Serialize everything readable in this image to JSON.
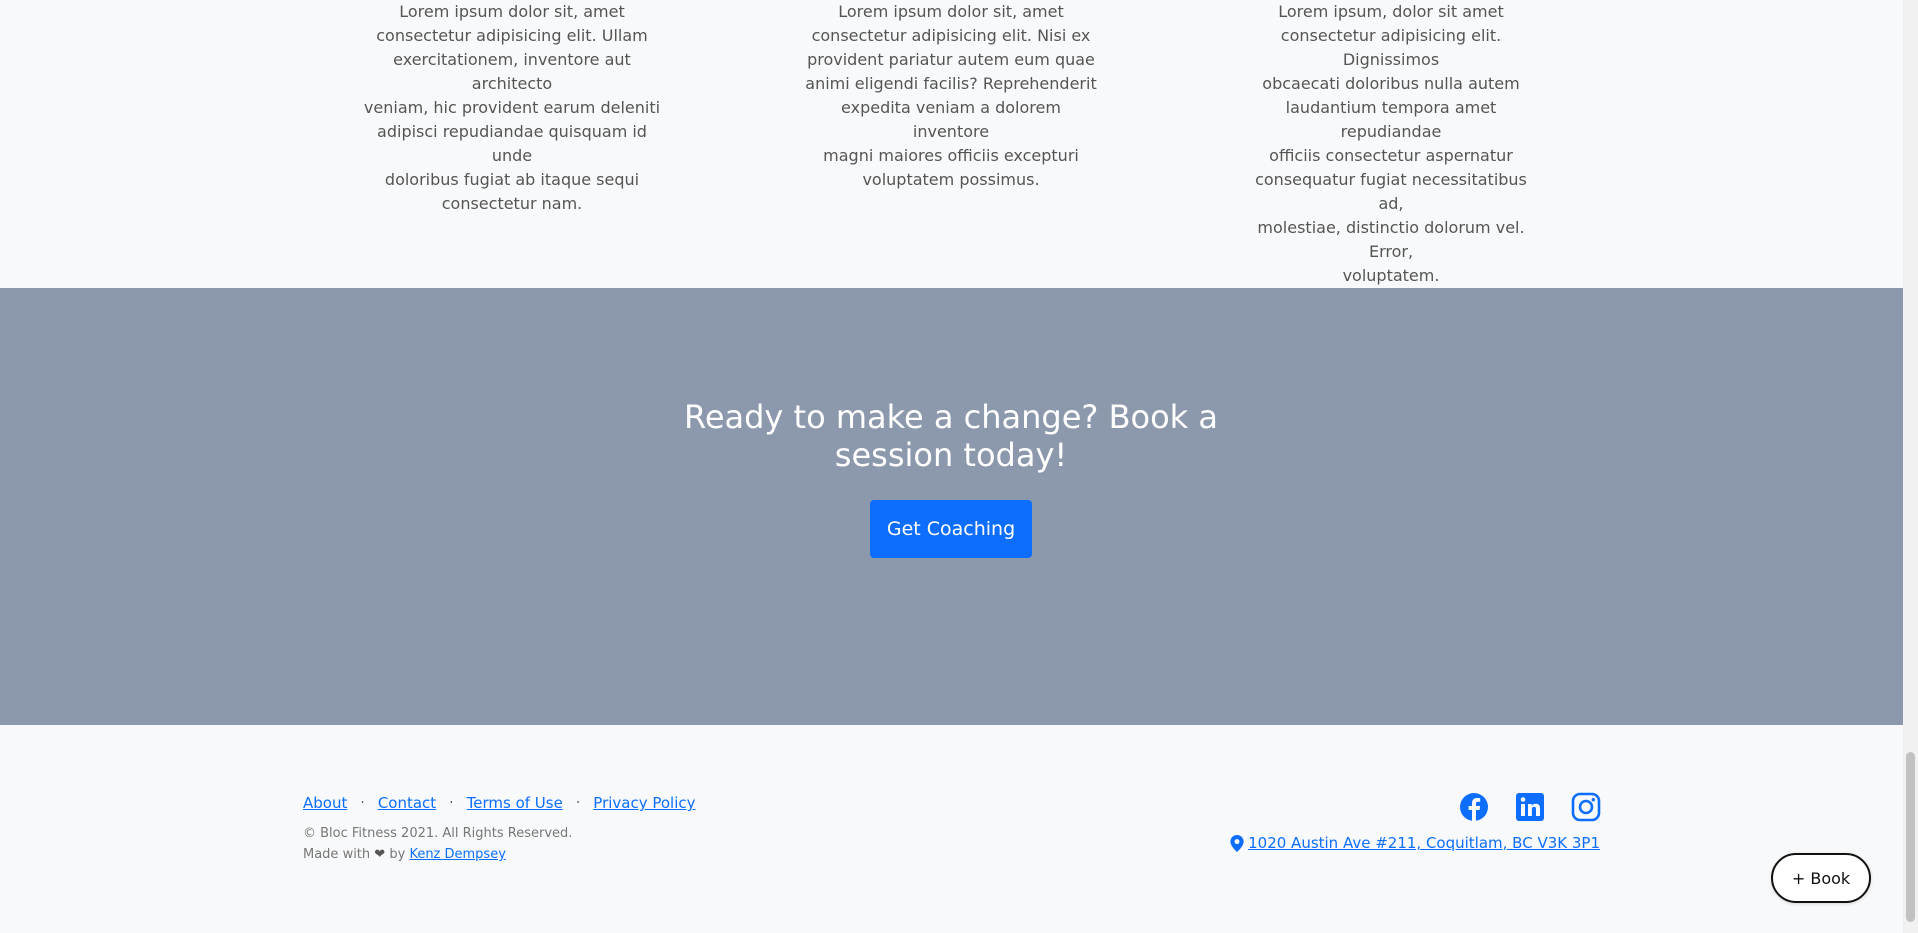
{
  "features": [
    {
      "text": "Lorem ipsum dolor sit, amet\nconsectetur adipisicing elit. Ullam\nexercitationem, inventore aut architecto\nveniam, hic provident earum deleniti\nadipisci repudiandae quisquam id unde\ndoloribus fugiat ab itaque sequi\nconsectetur nam."
    },
    {
      "text": "Lorem ipsum dolor sit, amet\nconsectetur adipisicing elit. Nisi ex\nprovident pariatur autem eum quae\nanimi eligendi facilis? Reprehenderit\nexpedita veniam a dolorem inventore\nmagni maiores officiis excepturi\nvoluptatem possimus."
    },
    {
      "text": "Lorem ipsum, dolor sit amet\nconsectetur adipisicing elit. Dignissimos\nobcaecati doloribus nulla autem\nlaudantium tempora amet repudiandae\nofficiis consectetur aspernatur\nconsequatur fugiat necessitatibus ad,\nmolestiae, distinctio dolorum vel. Error,\nvoluptatem."
    }
  ],
  "cta": {
    "heading": "Ready to make a change? Book a session today!",
    "button_label": "Get Coaching"
  },
  "footer": {
    "links": [
      "About",
      "Contact",
      "Terms of Use",
      "Privacy Policy"
    ],
    "separator": "·",
    "copyright": "© Bloc Fitness 2021. All Rights Reserved.",
    "made_with_prefix": "Made with",
    "made_with_by": "by",
    "author": "Kenz Dempsey",
    "address": "1020 Austin Ave #211, Coquitlam, BC V3K 3P1",
    "social_icons": [
      "facebook-icon",
      "linkedin-icon",
      "instagram-icon"
    ]
  },
  "book_button": {
    "label": "+ Book"
  },
  "colors": {
    "accent": "#0d6efd",
    "cta_background": "#8c99ac",
    "page_background": "#f8f9fa"
  }
}
